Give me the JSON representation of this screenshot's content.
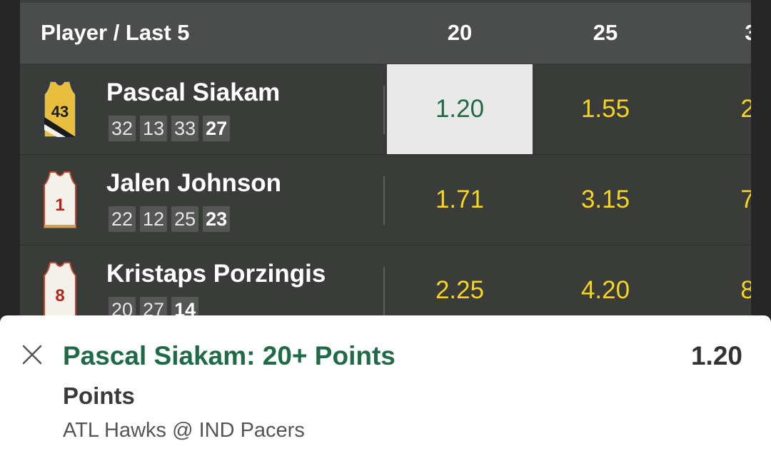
{
  "header": {
    "title": "Player / Last 5",
    "columns": [
      "20",
      "25",
      "3"
    ]
  },
  "rows": [
    {
      "player": "Pascal Siakam",
      "jersey_number": "43",
      "jersey_icon": "pacers-yellow-jersey-icon",
      "last5": [
        "32",
        "13",
        "33",
        "27"
      ],
      "odds": [
        "1.20",
        "1.55",
        "2."
      ]
    },
    {
      "player": "Jalen Johnson",
      "jersey_number": "1",
      "jersey_icon": "hawks-white-jersey-icon",
      "last5": [
        "22",
        "12",
        "25",
        "23"
      ],
      "odds": [
        "1.71",
        "3.15",
        "7."
      ]
    },
    {
      "player": "Kristaps Porzingis",
      "jersey_number": "8",
      "jersey_icon": "hawks-white-jersey-icon",
      "last5": [
        "20",
        "27",
        "14"
      ],
      "odds": [
        "2.25",
        "4.20",
        "8."
      ]
    }
  ],
  "selected_odd": "1.20",
  "betslip": {
    "selection": "Pascal Siakam: 20+ Points",
    "price": "1.20",
    "market": "Points",
    "event": "ATL Hawks @ IND Pacers",
    "close_icon": "close-icon"
  },
  "colors": {
    "odds_yellow": "#f7d51d",
    "accent_green": "#1f6b47",
    "row_bg": "#3a3c3a",
    "header_bg": "#4a4d4b",
    "selected_bg": "#e9e9e9"
  }
}
